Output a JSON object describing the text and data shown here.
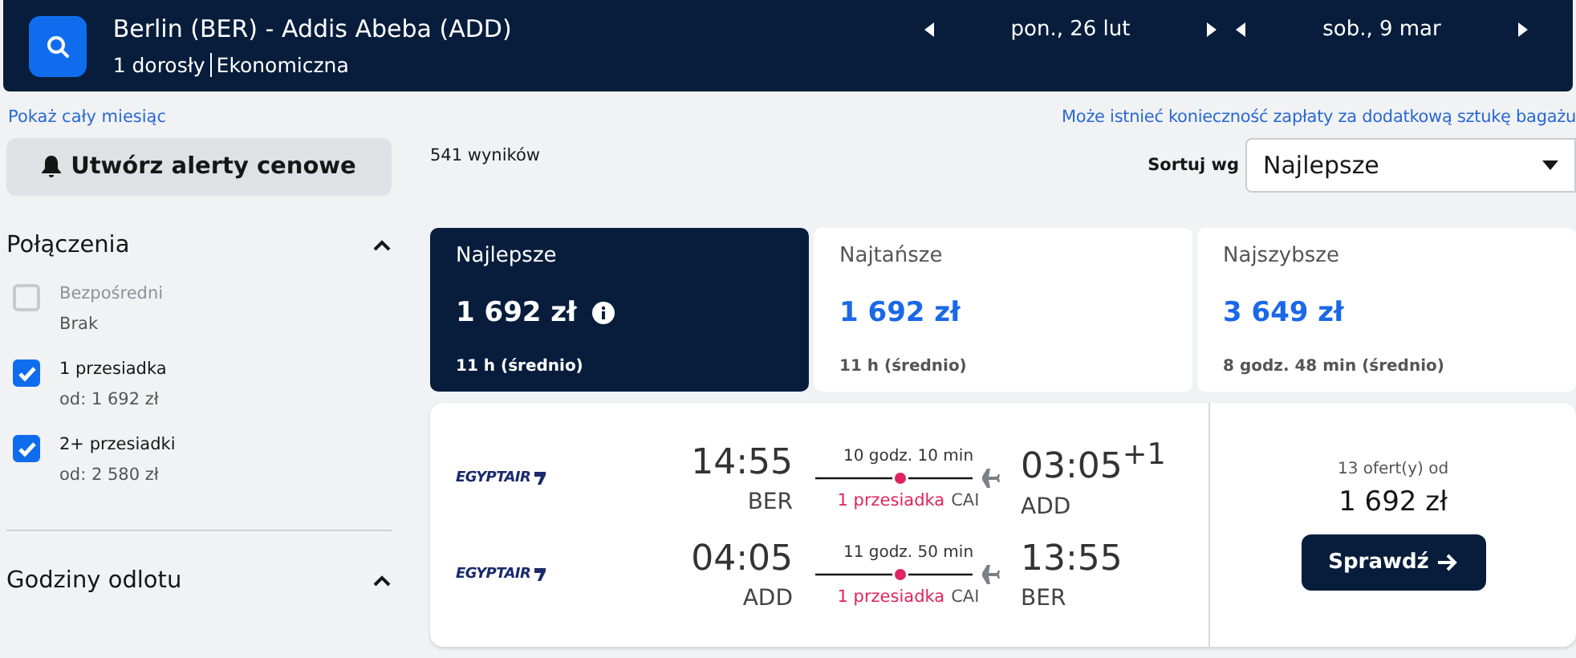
{
  "header": {
    "route": "Berlin (BER) - Addis Abeba (ADD)",
    "passengers": "1 dorosły",
    "cabin": "Ekonomiczna",
    "dates": [
      {
        "label": "pon., 26 lut"
      },
      {
        "label": "sob., 9 mar"
      }
    ]
  },
  "links": {
    "month": "Pokaż cały miesiąc",
    "baggage": "Może istnieć konieczność zapłaty za dodatkową sztukę bagażu"
  },
  "alert_button": "Utwórz alerty cenowe",
  "filters": [
    {
      "title": "Połączenia",
      "expanded": true,
      "options": [
        {
          "label": "Bezpośredni",
          "sub": "Brak",
          "checked": false,
          "disabled": true
        },
        {
          "label": "1 przesiadka",
          "sub": "od: 1 692 zł",
          "checked": true,
          "disabled": false
        },
        {
          "label": "2+ przesiadki",
          "sub": "od: 2 580 zł",
          "checked": true,
          "disabled": false
        }
      ]
    },
    {
      "title": "Godziny odlotu",
      "expanded": true
    }
  ],
  "results_count": "541 wyników",
  "sort": {
    "label": "Sortuj wg",
    "value": "Najlepsze"
  },
  "sort_tabs": [
    {
      "label": "Najlepsze",
      "price": "1 692 zł",
      "duration": "11 h (średnio)",
      "selected": true,
      "info": true
    },
    {
      "label": "Najtańsze",
      "price": "1 692 zł",
      "duration": "11 h (średnio)",
      "selected": false,
      "info": false
    },
    {
      "label": "Najszybsze",
      "price": "3 649 zł",
      "duration": "8 godz. 48 min (średnio)",
      "selected": false,
      "info": false
    }
  ],
  "result": {
    "legs": [
      {
        "airline": "EGYPTAIR",
        "dep_time": "14:55",
        "dep_code": "BER",
        "duration": "10 godz. 10 min",
        "stops": "1 przesiadka",
        "via": "CAI",
        "arr_time": "03:05$^{+1}$",
        "arr_code": "ADD"
      },
      {
        "airline": "EGYPTAIR",
        "dep_time": "04:05",
        "dep_code": "ADD",
        "duration": "11 godz. 50 min",
        "stops": "1 przesiadka",
        "via": "CAI",
        "arr_time": "13:55",
        "arr_code": "BER"
      }
    ],
    "offers": "13 ofert(y) od",
    "price": "1 692 zł",
    "button": "Sprawdź"
  }
}
